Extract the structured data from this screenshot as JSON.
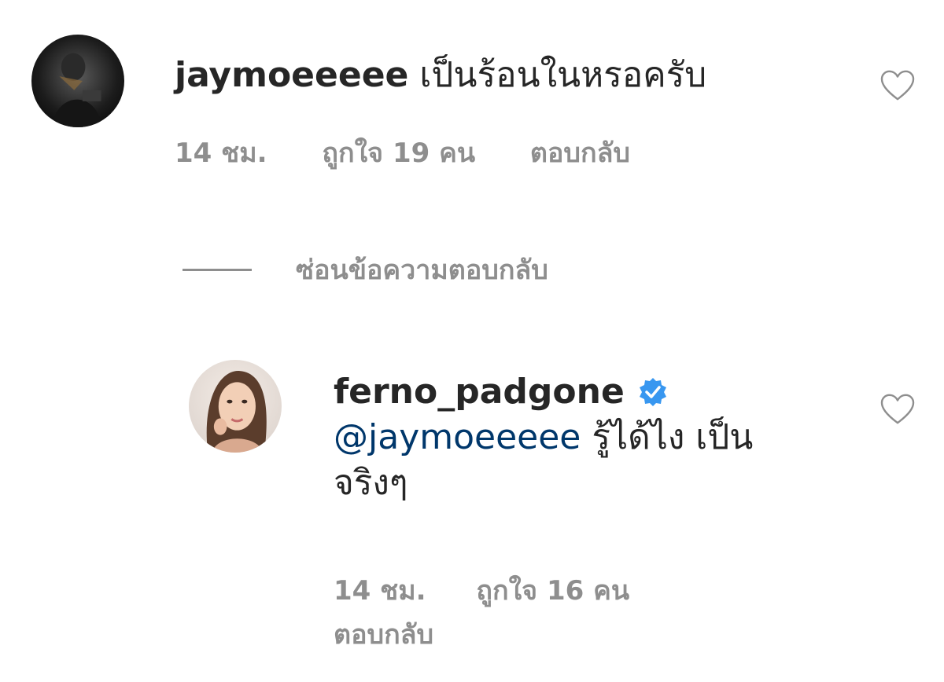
{
  "comment": {
    "username": "jaymoeeeee",
    "text": "เป็นร้อนในหรอครับ",
    "time": "14 ชม.",
    "likes": "ถูกใจ 19 คน",
    "reply_label": "ตอบกลับ",
    "avatar_icon": "user-avatar-photo",
    "like_icon": "heart-outline-icon"
  },
  "hide_replies": {
    "label": "ซ่อนข้อความตอบกลับ"
  },
  "reply": {
    "username": "ferno_padgone",
    "verified_icon": "verified-badge-icon",
    "mention": "@jaymoeeeee",
    "text_line1": "รู้ได้ไง เป็น",
    "text_line2": "จริงๆ",
    "time": "14 ชม.",
    "likes": "ถูกใจ 16 คน",
    "reply_label": "ตอบกลับ",
    "avatar_icon": "user-avatar-photo",
    "like_icon": "heart-outline-icon"
  },
  "colors": {
    "text": "#262626",
    "secondary": "#8e8e8e",
    "mention": "#00376b",
    "verified": "#3897f0"
  }
}
